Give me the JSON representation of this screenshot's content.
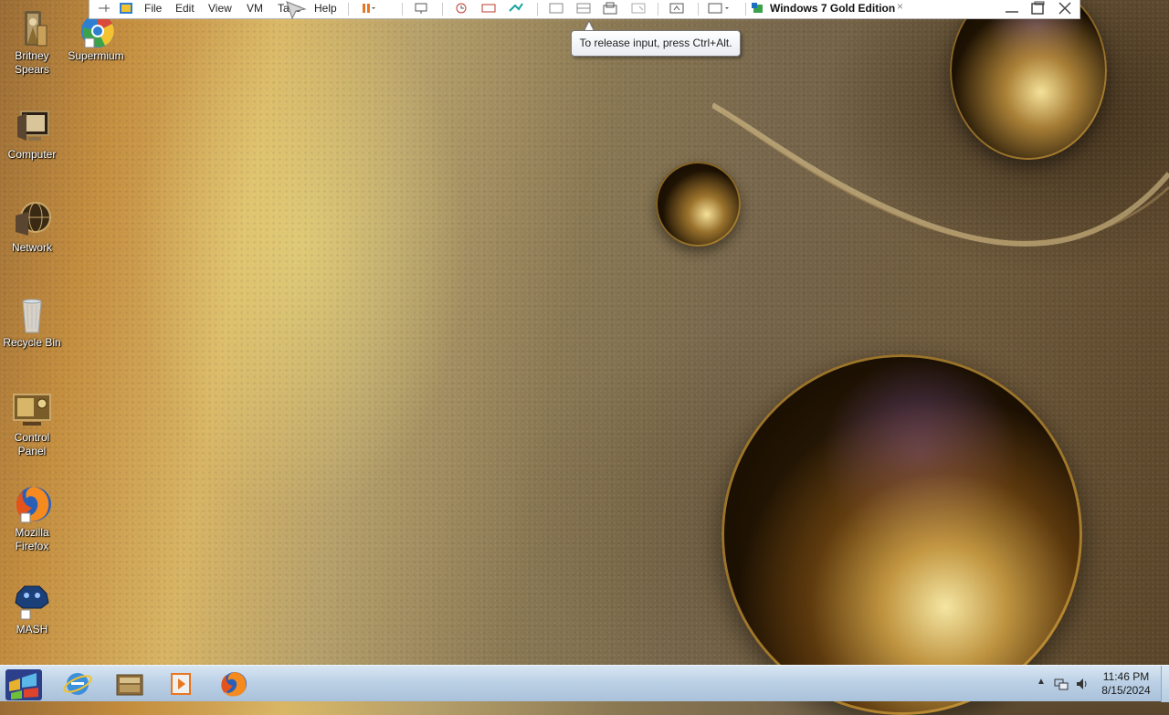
{
  "vm_toolbar": {
    "menus": [
      "File",
      "Edit",
      "View",
      "VM",
      "Tabs",
      "Help"
    ],
    "vm_title": "Windows 7 Gold Edition",
    "title_close": "×"
  },
  "tooltip": {
    "text": "To release input, press Ctrl+Alt."
  },
  "desktop_icons": [
    {
      "label": "Britney Spears",
      "icon": "folder-person-icon"
    },
    {
      "label": "Supermium",
      "icon": "supermium-browser-icon"
    },
    {
      "label": "Computer",
      "icon": "computer-icon"
    },
    {
      "label": "Network",
      "icon": "network-icon"
    },
    {
      "label": "Recycle Bin",
      "icon": "recycle-bin-icon"
    },
    {
      "label": "Control Panel",
      "icon": "control-panel-icon"
    },
    {
      "label": "Mozilla Firefox",
      "icon": "firefox-icon"
    },
    {
      "label": "MASH",
      "icon": "mash-icon"
    }
  ],
  "taskbar": {
    "pinned": [
      "internet-explorer-icon",
      "windows-explorer-icon",
      "media-player-icon",
      "firefox-icon"
    ],
    "tray": {
      "arrow": "▲",
      "icons": [
        "network-tray-icon",
        "volume-icon"
      ]
    },
    "clock": {
      "time": "11:46 PM",
      "date": "8/15/2024"
    }
  },
  "colors": {
    "taskbar": "#bcd1e6",
    "tooltip_border": "#767676"
  }
}
